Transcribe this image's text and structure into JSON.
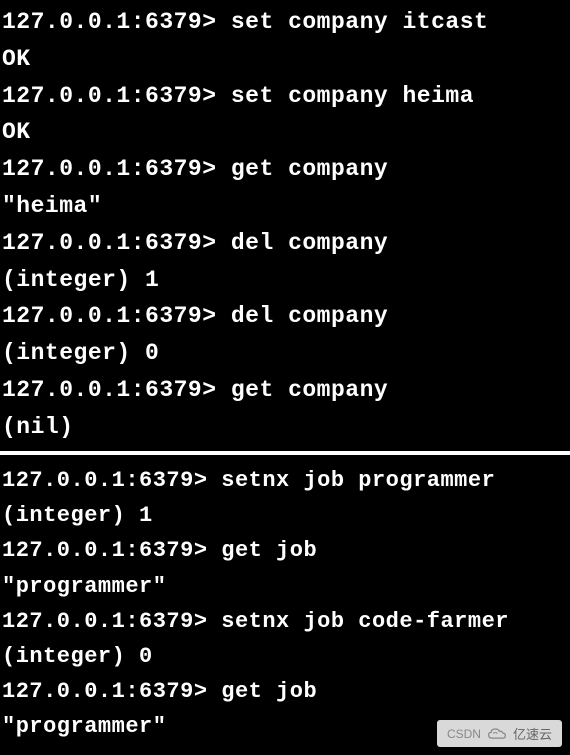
{
  "prompt": "127.0.0.1:6379>",
  "block1": {
    "lines": [
      {
        "type": "cmd",
        "text": "set company itcast"
      },
      {
        "type": "out",
        "text": "OK"
      },
      {
        "type": "cmd",
        "text": "set company heima"
      },
      {
        "type": "out",
        "text": "OK"
      },
      {
        "type": "cmd",
        "text": "get company"
      },
      {
        "type": "out",
        "text": "\"heima\""
      },
      {
        "type": "cmd",
        "text": "del company"
      },
      {
        "type": "out",
        "text": "(integer) 1"
      },
      {
        "type": "cmd",
        "text": "del company"
      },
      {
        "type": "out",
        "text": "(integer) 0"
      },
      {
        "type": "cmd",
        "text": "get company"
      },
      {
        "type": "out",
        "text": "(nil)"
      }
    ]
  },
  "block2": {
    "lines": [
      {
        "type": "cmd",
        "text": "setnx job programmer"
      },
      {
        "type": "out",
        "text": "(integer) 1"
      },
      {
        "type": "cmd",
        "text": "get job"
      },
      {
        "type": "out",
        "text": "\"programmer\""
      },
      {
        "type": "cmd",
        "text": "setnx job code-farmer"
      },
      {
        "type": "out",
        "text": "(integer) 0"
      },
      {
        "type": "cmd",
        "text": "get job"
      },
      {
        "type": "out",
        "text": "\"programmer\""
      }
    ]
  },
  "watermark": {
    "left_text": "CSDN",
    "brand": "亿速云"
  }
}
